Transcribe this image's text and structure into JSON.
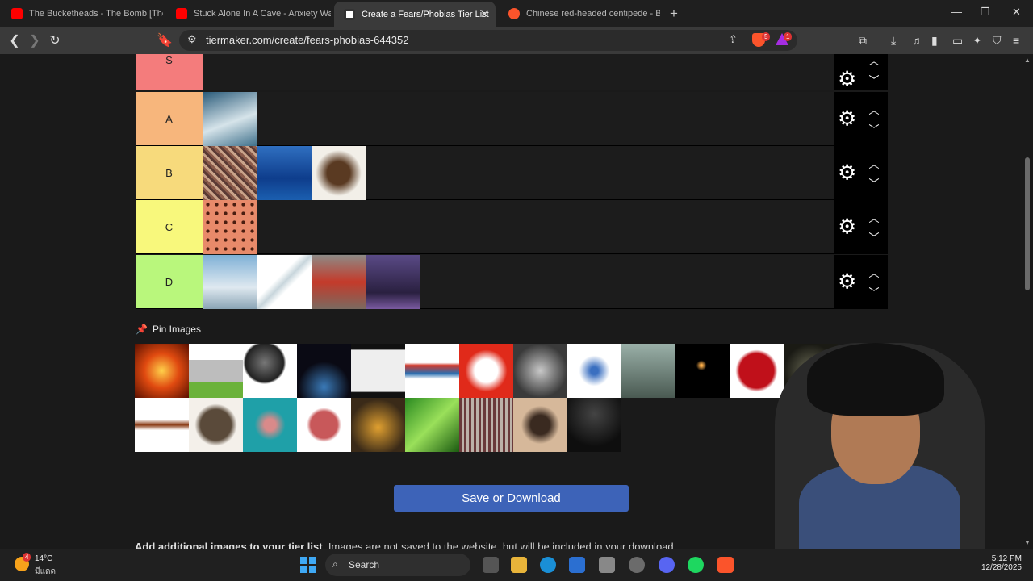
{
  "tabs": [
    {
      "title": "The Bucketheads - The Bomb [These",
      "favicon": "youtube"
    },
    {
      "title": "Stuck Alone In A Cave - Anxiety Warr",
      "favicon": "youtube"
    },
    {
      "title": "Create a Fears/Phobias Tier List",
      "favicon": "tiermaker",
      "active": true
    },
    {
      "title": "Chinese red-headed centipede - Brav",
      "favicon": "brave"
    }
  ],
  "address": {
    "url": "tiermaker.com/create/fears-phobias-644352"
  },
  "toolbar_badges": {
    "shield_count": "5",
    "rewards_count": "1"
  },
  "tiers": [
    {
      "label": "S",
      "color": "#f47c7c",
      "items": []
    },
    {
      "label": "A",
      "color": "#f7b67c",
      "items": [
        "shark"
      ]
    },
    {
      "label": "B",
      "color": "#f7da7c",
      "items": [
        "crowd",
        "ocean",
        "tarantula"
      ]
    },
    {
      "label": "C",
      "color": "#f8f87c",
      "items": [
        "holes"
      ]
    },
    {
      "label": "D",
      "color": "#b9f77c",
      "items": [
        "airplane",
        "syringe",
        "puppet",
        "lightning"
      ]
    }
  ],
  "pin_section": {
    "label": "Pin Images"
  },
  "pool_items": [
    "fire",
    "grave",
    "microphone",
    "asteroid",
    "window",
    "knot",
    "clown",
    "man-portrait",
    "virus",
    "heights",
    "candle-dark",
    "blood",
    "gas-mask",
    "cockroach",
    "rat",
    "isopod",
    "worm",
    "lizard",
    "snake",
    "centipede",
    "scorpion",
    "darkness"
  ],
  "save_button": {
    "label": "Save or Download"
  },
  "footer_note": {
    "bold": "Add additional images to your tier list.",
    "text": " Images are not saved to the website, but will be included in your download."
  },
  "taskbar": {
    "weather_temp": "14°C",
    "weather_cond": "มีแดด",
    "weather_badge": "4",
    "search_label": "Search",
    "time": "5:12 PM",
    "date": "12/28/2025"
  }
}
